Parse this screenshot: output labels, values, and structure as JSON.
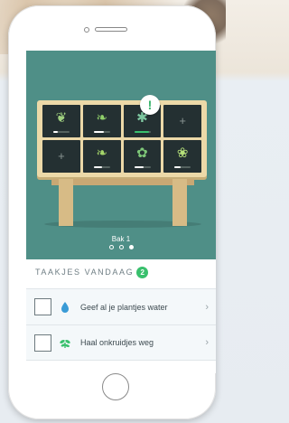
{
  "hero": {
    "box_label": "Bak 1",
    "pager": {
      "count": 3,
      "active_index": 2
    },
    "alert_symbol": "!"
  },
  "grid": [
    {
      "icon": "seedling-icon",
      "symbol": "❦",
      "color": "#9fd07f",
      "progress": 0.3
    },
    {
      "icon": "seedling-icon",
      "symbol": "❧",
      "color": "#8fcf6a",
      "progress": 0.6
    },
    {
      "icon": "leaf-icon",
      "symbol": "✱",
      "color": "#7ec7a0",
      "progress": 0.9
    },
    {
      "icon": "plus-icon",
      "symbol": "+",
      "color": "",
      "progress": null
    },
    {
      "icon": "plus-icon",
      "symbol": "+",
      "color": "",
      "progress": null
    },
    {
      "icon": "seedling-icon",
      "symbol": "❧",
      "color": "#a4d46a",
      "progress": 0.5
    },
    {
      "icon": "leaf-icon",
      "symbol": "✿",
      "color": "#7ec778",
      "progress": 0.6
    },
    {
      "icon": "lettuce-icon",
      "symbol": "❀",
      "color": "#b6e07a",
      "progress": 0.4
    }
  ],
  "tasks": {
    "title": "TAAKJES VANDAAG",
    "count": "2",
    "items": [
      {
        "label": "Geef al je plantjes water",
        "icon": "water-drop-icon"
      },
      {
        "label": "Haal onkruidjes weg",
        "icon": "weed-icon"
      }
    ]
  },
  "colors": {
    "hero_bg": "#4f8f87",
    "accent_green": "#39c06d",
    "water_blue": "#3a9bd6"
  }
}
